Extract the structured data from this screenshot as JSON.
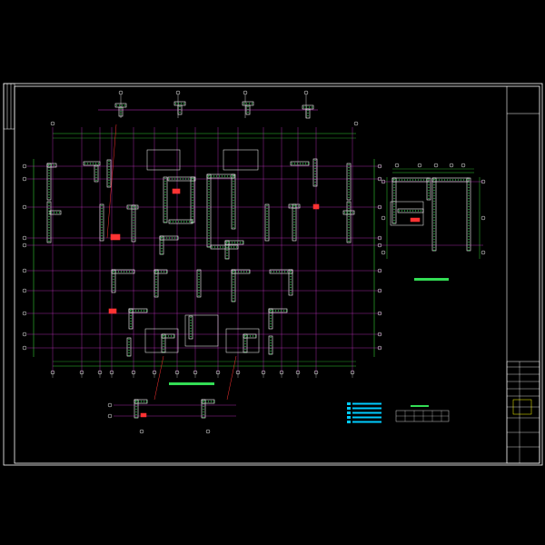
{
  "drawing": {
    "background_color": "#000000",
    "frame_color": "#ffffff",
    "grid_color": "#cc33cc",
    "dim_color": "#33cc33",
    "wall_color": "#ffffff",
    "rebar_color": "#33dd55",
    "highlight_color": "#ff3333",
    "legend_text_color": "#00ccff"
  },
  "title_block": {
    "rows": [
      "",
      "",
      "",
      "",
      "",
      "",
      "",
      "",
      ""
    ]
  },
  "notes": {
    "legend_items": [
      "",
      "",
      "",
      "",
      ""
    ],
    "table_cells": [
      "",
      "",
      "",
      "",
      "",
      "",
      "",
      ""
    ]
  }
}
